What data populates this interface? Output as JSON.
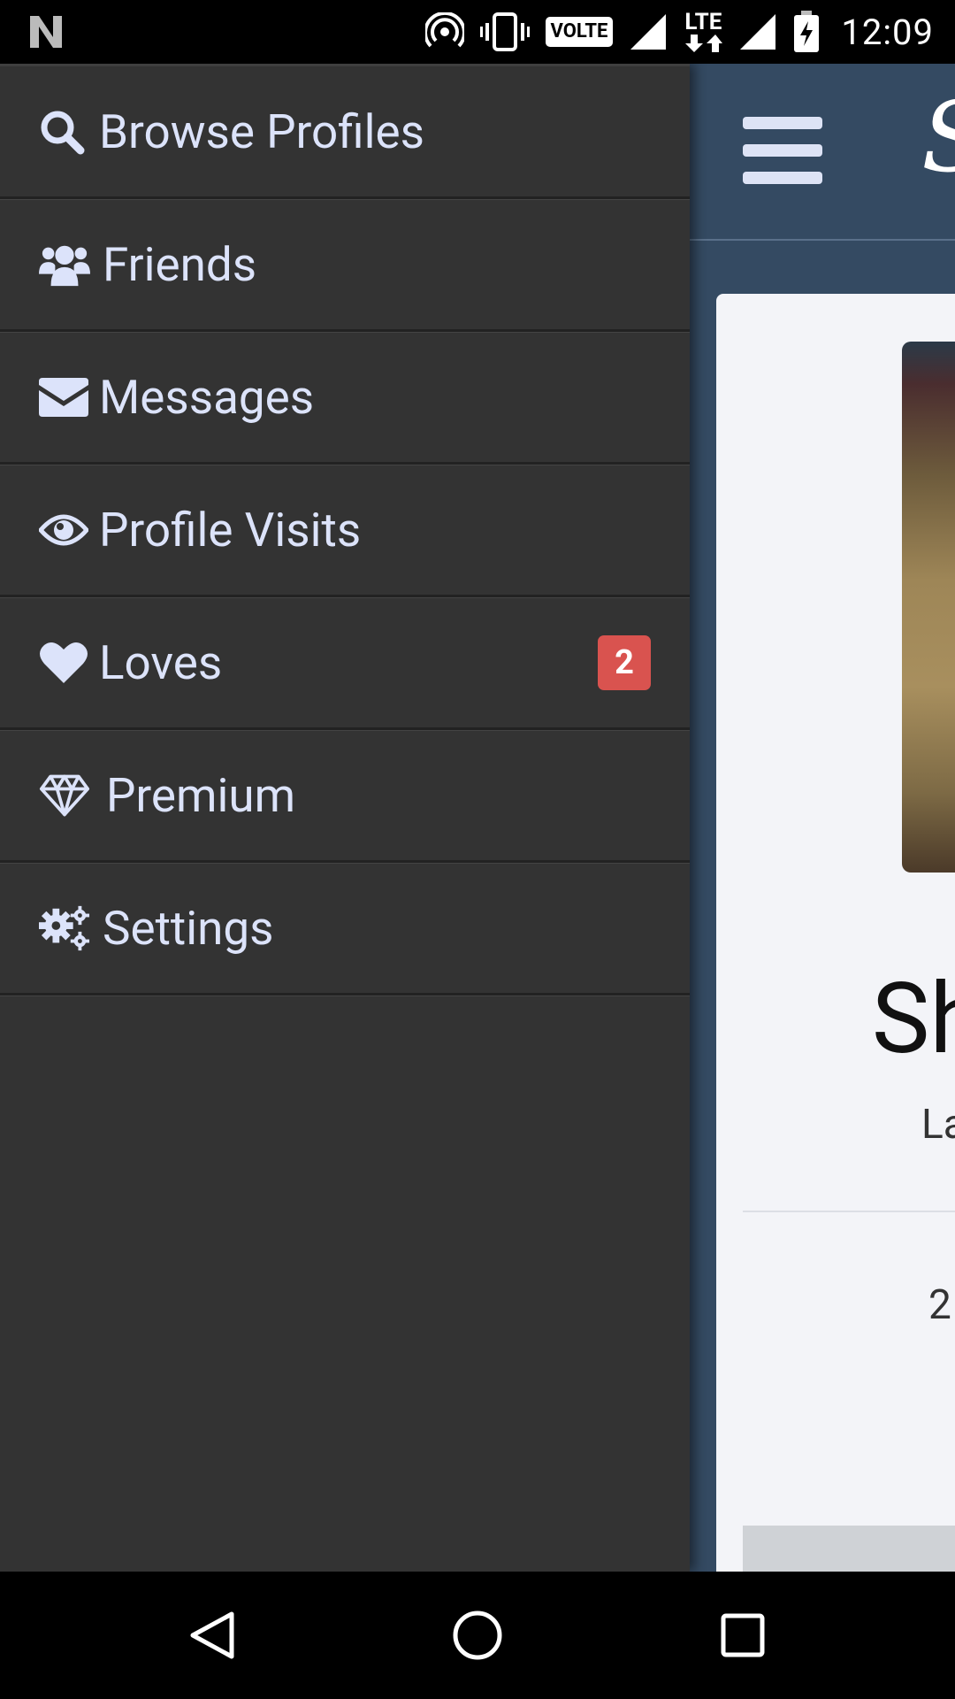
{
  "status_bar": {
    "volte_label": "VOLTE",
    "lte_label": "LTE",
    "time": "12:09"
  },
  "drawer": {
    "items": [
      {
        "label": "Browse Profiles",
        "icon": "search-icon"
      },
      {
        "label": "Friends",
        "icon": "users-icon"
      },
      {
        "label": "Messages",
        "icon": "envelope-icon"
      },
      {
        "label": "Profile Visits",
        "icon": "eye-icon"
      },
      {
        "label": "Loves",
        "icon": "heart-icon",
        "badge": "2"
      },
      {
        "label": "Premium",
        "icon": "diamond-icon"
      },
      {
        "label": "Settings",
        "icon": "gears-icon"
      }
    ]
  },
  "profile": {
    "name_partial": "Sh",
    "subtitle_partial": "La",
    "stat_partial": "2"
  },
  "colors": {
    "drawer_bg": "#333333",
    "menu_text": "#dce3fa",
    "badge_bg": "#d9534f",
    "app_header_bg": "#344a62"
  }
}
